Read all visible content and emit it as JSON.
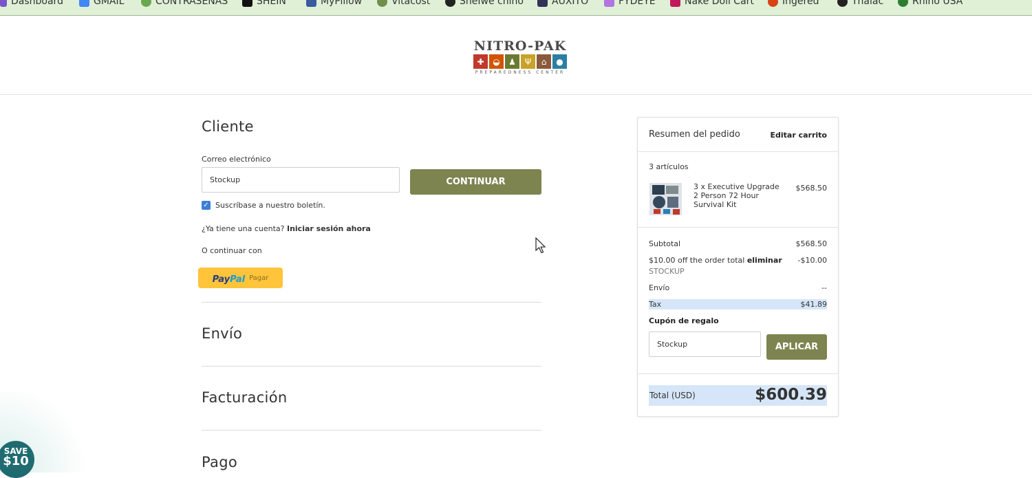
{
  "bookmarks": [
    {
      "label": "Dashboard",
      "color": "#7a55c9"
    },
    {
      "label": "GMAIL",
      "color": "#4285f4"
    },
    {
      "label": "CONTRASEÑAS",
      "color": "#6aa84f"
    },
    {
      "label": "SHEIN",
      "color": "#111111"
    },
    {
      "label": "MyPillow",
      "color": "#3a5ba0"
    },
    {
      "label": "Vitacost",
      "color": "#6f8f4a"
    },
    {
      "label": "SheIwe chino",
      "color": "#222222"
    },
    {
      "label": "AUXITO",
      "color": "#333355"
    },
    {
      "label": "FYDEYE",
      "color": "#b174e0"
    },
    {
      "label": "Nake Doll Cart",
      "color": "#c2185b"
    },
    {
      "label": "Ingered",
      "color": "#d84315"
    },
    {
      "label": "Thalac",
      "color": "#222222"
    },
    {
      "label": "Rhino USA",
      "color": "#2e7d32"
    }
  ],
  "logo": {
    "title": "NITRO-PAK",
    "subtitle": "PREPAREDNESS CENTER",
    "tiles": [
      {
        "icon": "medical-cross-icon",
        "glyph": "✚",
        "color": "#c0392b"
      },
      {
        "icon": "food-bowl-icon",
        "glyph": "◒",
        "color": "#d35400"
      },
      {
        "icon": "hiker-icon",
        "glyph": "🚶",
        "color": "#6b7a32"
      },
      {
        "icon": "fork-knife-icon",
        "glyph": "🍴",
        "color": "#c9a227"
      },
      {
        "icon": "house-icon",
        "glyph": "⌂",
        "color": "#8a5a3b"
      },
      {
        "icon": "water-drop-icon",
        "glyph": "💧",
        "color": "#2b7fa3"
      }
    ]
  },
  "customer": {
    "heading": "Cliente",
    "email_label": "Correo electrónico",
    "email_value": "Stockup",
    "continue_label": "CONTINUAR",
    "newsletter_label": "Suscríbase a nuestro boletín.",
    "newsletter_checked": true,
    "account_question": "¿Ya tiene una cuenta?",
    "signin_link": "Iniciar sesión ahora",
    "or_continue": "O continuar con",
    "paypal": {
      "part1": "Pay",
      "part2": "Pal",
      "action": "Pagar"
    }
  },
  "sections": {
    "shipping": "Envío",
    "billing": "Facturación",
    "payment": "Pago"
  },
  "summary": {
    "title": "Resumen del pedido",
    "edit_cart": "Editar carrito",
    "item_count": "3 artículos",
    "items": [
      {
        "name": "3 x Executive Upgrade 2 Person 72 Hour Survival Kit",
        "price": "$568.50"
      }
    ],
    "subtotal_label": "Subtotal",
    "subtotal_value": "$568.50",
    "discount_label": "$10.00 off the order total",
    "discount_remove": "eliminar",
    "discount_code": "STOCKUP",
    "discount_value": "-$10.00",
    "shipping_label": "Envío",
    "shipping_value": "--",
    "tax_label": "Tax",
    "tax_value": "$41.89",
    "gift_label": "Cupón de regalo",
    "gift_value": "Stockup",
    "apply_label": "APLICAR",
    "total_label": "Total (USD)",
    "total_value": "$600.39"
  },
  "promo": {
    "line1": "SAVE",
    "line2": "$10"
  },
  "colors": {
    "olive": "#7d8450",
    "paypal": "#ffc439",
    "highlight": "#d6e6f8",
    "checkbox": "#3c7fd6"
  }
}
